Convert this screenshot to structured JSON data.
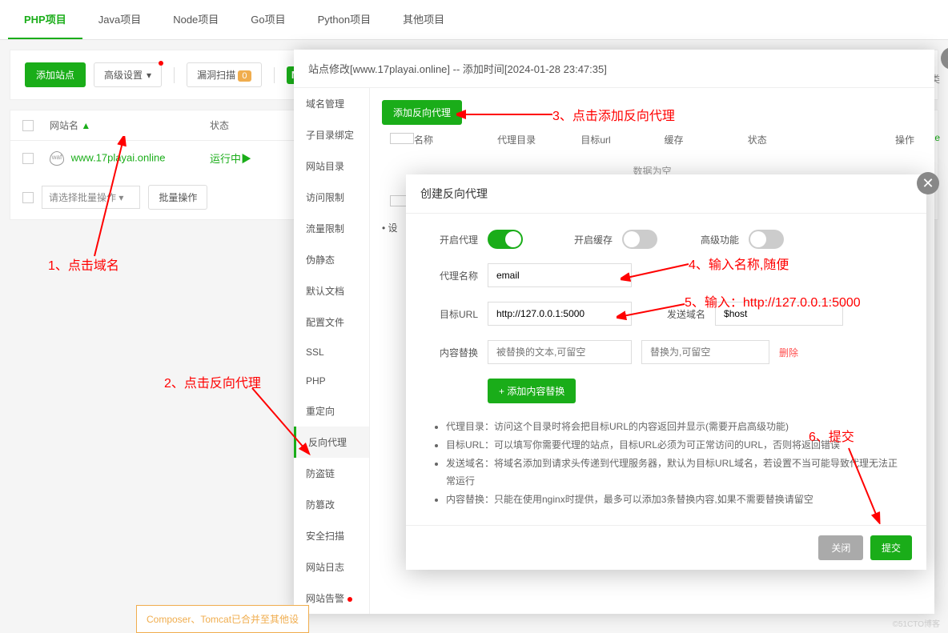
{
  "tabs": [
    {
      "label": "PHP项目",
      "active": true
    },
    {
      "label": "Java项目",
      "active": false
    },
    {
      "label": "Node项目",
      "active": false
    },
    {
      "label": "Go项目",
      "active": false
    },
    {
      "label": "Python项目",
      "active": false
    },
    {
      "label": "其他项目",
      "active": false
    }
  ],
  "toolbar": {
    "add_site": "添加站点",
    "adv_settings": "高级设置",
    "vuln_scan": "漏洞扫描",
    "vuln_count": "0",
    "default_category_suffix": "认分类"
  },
  "table": {
    "col_name": "网站名",
    "col_status": "状态",
    "site": "www.17playai.online",
    "status": "运行中",
    "online_suffix": "nline",
    "select_placeholder": "请选择批量操作",
    "batch_btn": "批量操作"
  },
  "modal1": {
    "title": "站点修改[www.17playai.online] -- 添加时间[2024-01-28 23:47:35]",
    "sidebar": [
      "域名管理",
      "子目录绑定",
      "网站目录",
      "访问限制",
      "流量限制",
      "伪静态",
      "默认文档",
      "配置文件",
      "SSL",
      "PHP",
      "重定向",
      "反向代理",
      "防盗链",
      "防篡改",
      "安全扫描",
      "网站日志",
      "网站告警"
    ],
    "add_proxy_btn": "添加反向代理",
    "cols": {
      "name": "名称",
      "dir": "代理目录",
      "url": "目标url",
      "cache": "缓存",
      "status": "状态",
      "op": "操作"
    },
    "empty": "数据为空",
    "setting_prefix": "设"
  },
  "modal2": {
    "title": "创建反向代理",
    "enable_proxy": "开启代理",
    "enable_cache": "开启缓存",
    "adv_func": "高级功能",
    "proxy_name_label": "代理名称",
    "proxy_name_value": "email",
    "target_url_label": "目标URL",
    "target_url_value": "http://127.0.0.1:5000",
    "send_domain_label": "发送域名",
    "send_domain_value": "$host",
    "content_replace": "内容替换",
    "replace_ph1": "被替换的文本,可留空",
    "replace_ph2": "替换为,可留空",
    "delete": "删除",
    "add_replace": "+ 添加内容替换",
    "tips": [
      "代理目录：访问这个目录时将会把目标URL的内容返回并显示(需要开启高级功能)",
      "目标URL：可以填写你需要代理的站点，目标URL必须为可正常访问的URL，否则将返回错误",
      "发送域名：将域名添加到请求头传递到代理服务器，默认为目标URL域名，若设置不当可能导致代理无法正常运行",
      "内容替换：只能在使用nginx时提供，最多可以添加3条替换内容,如果不需要替换请留空"
    ],
    "close_btn": "关闭",
    "submit_btn": "提交"
  },
  "annotations": {
    "a1": "1、点击域名",
    "a2": "2、点击反向代理",
    "a3": "3、点击添加反向代理",
    "a4": "4、输入名称,随便",
    "a5": "5、输入：http://127.0.0.1:5000",
    "a6": "6、提交"
  },
  "footer_notice": "Composer、Tomcat已合并至其他设",
  "watermark": "©51CTO博客"
}
